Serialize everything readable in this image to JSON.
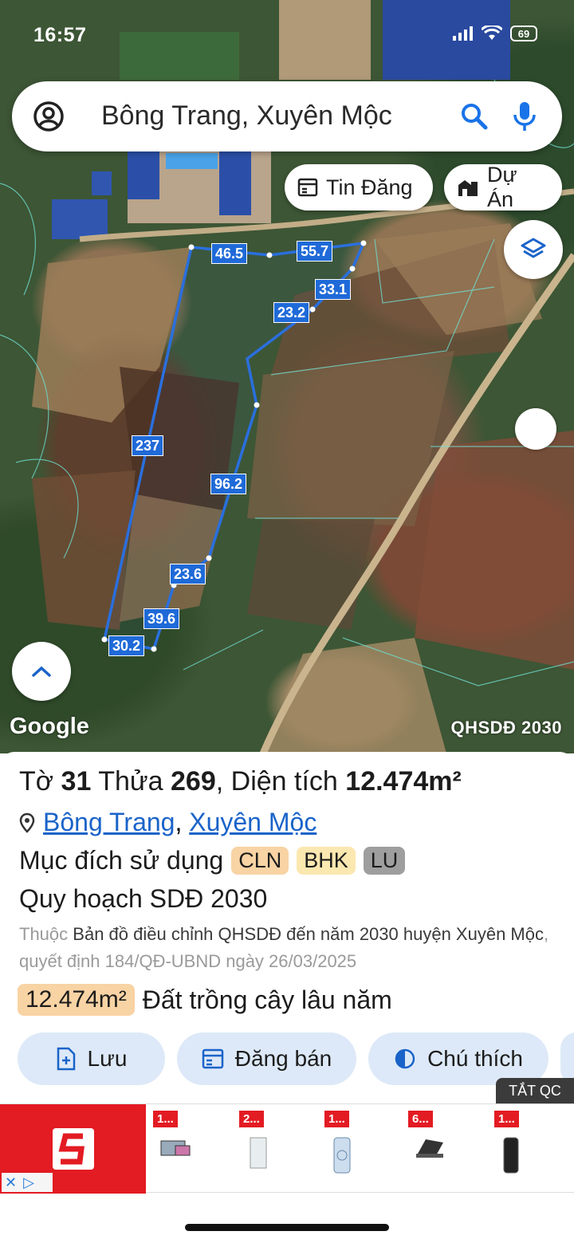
{
  "status_bar": {
    "time": "16:57",
    "battery": "69"
  },
  "search": {
    "query": "Bông Trang, Xuyên Mộc"
  },
  "chips": {
    "listings": "Tin Đăng",
    "projects": "Dự Án"
  },
  "map": {
    "attribution": "Google",
    "layer_name": "QHSDĐ 2030",
    "segments": [
      "46.5",
      "55.7",
      "33.1",
      "23.2",
      "237",
      "96.2",
      "23.6",
      "39.6",
      "30.2"
    ],
    "boundary_color": "#2a6fde"
  },
  "parcel": {
    "sheet_label": "Tờ",
    "sheet_no": "31",
    "plot_label": "Thửa",
    "plot_no": "269",
    "area_label": ", Diện tích",
    "area": "12.474m²",
    "commune": "Bông Trang",
    "separator": ",",
    "district": "Xuyên Mộc",
    "purpose_label": "Mục đích sử dụng",
    "tags": [
      "CLN",
      "BHK",
      "LU"
    ],
    "plan_title": "Quy hoạch SDĐ 2030",
    "desc_prefix": "Thuộc",
    "desc_map": "Bản đồ điều chỉnh QHSDĐ đến năm 2030 huyện Xuyên Mộc",
    "desc_suffix": ", quyết định 184/QĐ-UBND ngày 26/03/2025",
    "area_badge": "12.474m²",
    "land_type": "Đất trồng cây lâu năm"
  },
  "actions": {
    "save": "Lưu",
    "post": "Đăng bán",
    "legend": "Chú thích"
  },
  "ad": {
    "close_label": "TẮT QC",
    "item_prices": [
      "1...",
      "2...",
      "1...",
      "6...",
      "1..."
    ]
  },
  "colors": {
    "accent": "#1a63c9",
    "tag_cln": "#f8d3a4",
    "tag_bhk": "#fbe7b0",
    "tag_lu": "#9e9e9e",
    "button_bg": "#dde9f8"
  }
}
